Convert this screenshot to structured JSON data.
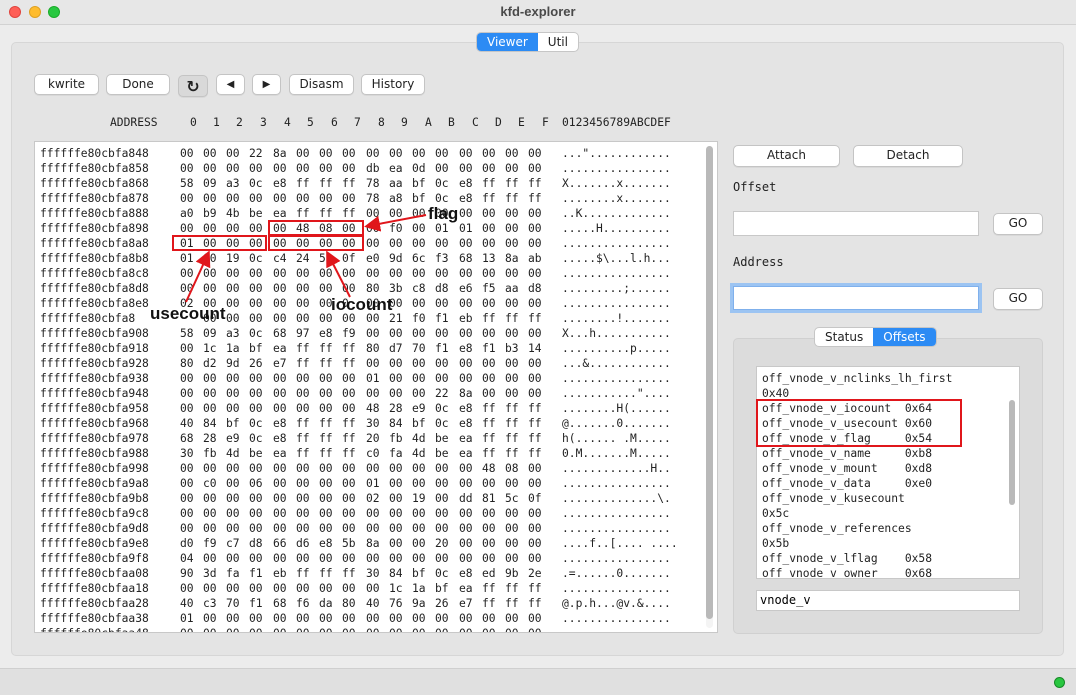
{
  "window": {
    "title": "kfd-explorer"
  },
  "tabs": [
    "Viewer",
    "Util"
  ],
  "toolbar": {
    "kwrite": "kwrite",
    "done": "Done",
    "refresh_icon": "↻",
    "prev_icon": "◀",
    "next_icon": "▶",
    "disasm": "Disasm",
    "history": "History"
  },
  "hex_header": {
    "address": "ADDRESS",
    "columns": [
      "0",
      "1",
      "2",
      "3",
      "4",
      "5",
      "6",
      "7",
      "8",
      "9",
      "A",
      "B",
      "C",
      "D",
      "E",
      "F"
    ],
    "ascii": "0123456789ABCDEF"
  },
  "hex_rows": [
    {
      "addr": "ffffffe80cbfa848",
      "bytes": [
        "00",
        "00",
        "00",
        "22",
        "8a",
        "00",
        "00",
        "00",
        "00",
        "00",
        "00",
        "00",
        "00",
        "00",
        "00",
        "00"
      ],
      "ascii": "...\"............"
    },
    {
      "addr": "ffffffe80cbfa858",
      "bytes": [
        "00",
        "00",
        "00",
        "00",
        "00",
        "00",
        "00",
        "00",
        "db",
        "ea",
        "0d",
        "00",
        "00",
        "00",
        "00",
        "00"
      ],
      "ascii": "................"
    },
    {
      "addr": "ffffffe80cbfa868",
      "bytes": [
        "58",
        "09",
        "a3",
        "0c",
        "e8",
        "ff",
        "ff",
        "ff",
        "78",
        "aa",
        "bf",
        "0c",
        "e8",
        "ff",
        "ff",
        "ff"
      ],
      "ascii": "X.......x......."
    },
    {
      "addr": "ffffffe80cbfa878",
      "bytes": [
        "00",
        "00",
        "00",
        "00",
        "00",
        "00",
        "00",
        "00",
        "78",
        "a8",
        "bf",
        "0c",
        "e8",
        "ff",
        "ff",
        "ff"
      ],
      "ascii": "........x......."
    },
    {
      "addr": "ffffffe80cbfa888",
      "bytes": [
        "a0",
        "b9",
        "4b",
        "be",
        "ea",
        "ff",
        "ff",
        "ff",
        "00",
        "00",
        "00",
        "00",
        "00",
        "00",
        "00",
        "00"
      ],
      "ascii": "..K............."
    },
    {
      "addr": "ffffffe80cbfa898",
      "bytes": [
        "00",
        "00",
        "00",
        "00",
        "00",
        "48",
        "08",
        "00",
        "00",
        "f0",
        "00",
        "01",
        "01",
        "00",
        "00",
        "00"
      ],
      "ascii": ".....H.........."
    },
    {
      "addr": "ffffffe80cbfa8a8",
      "bytes": [
        "01",
        "00",
        "00",
        "00",
        "00",
        "00",
        "00",
        "00",
        "00",
        "00",
        "00",
        "00",
        "00",
        "00",
        "00",
        "00"
      ],
      "ascii": "................"
    },
    {
      "addr": "ffffffe80cbfa8b8",
      "bytes": [
        "01",
        "00",
        "19",
        "0c",
        "c4",
        "24",
        "5",
        "0f",
        "e0",
        "9d",
        "6c",
        "f3",
        "68",
        "13",
        "8a",
        "ab"
      ],
      "ascii": ".....$\\...l.h..."
    },
    {
      "addr": "ffffffe80cbfa8c8",
      "bytes": [
        "00",
        "00",
        "00",
        "00",
        "00",
        "00",
        "00",
        "00",
        "00",
        "00",
        "00",
        "00",
        "00",
        "00",
        "00",
        "00"
      ],
      "ascii": "................"
    },
    {
      "addr": "ffffffe80cbfa8d8",
      "bytes": [
        "00",
        "00",
        "00",
        "00",
        "00",
        "00",
        "00",
        "00",
        "80",
        "3b",
        "c8",
        "d8",
        "e6",
        "f5",
        "aa",
        "d8"
      ],
      "ascii": ".........;......"
    },
    {
      "addr": "ffffffe80cbfa8e8",
      "bytes": [
        "02",
        "00",
        "00",
        "00",
        "00",
        "00",
        "00",
        "0",
        "00",
        "00",
        "00",
        "00",
        "00",
        "00",
        "00",
        "00"
      ],
      "ascii": "................"
    },
    {
      "addr": "ffffffe80cbfa8",
      "bytes": [
        "",
        "00",
        "00",
        "00",
        "00",
        "00",
        "00",
        "00",
        "00",
        "21",
        "f0",
        "f1",
        "eb",
        "ff",
        "ff",
        "ff"
      ],
      "ascii": "........!......."
    },
    {
      "addr": "ffffffe80cbfa908",
      "bytes": [
        "58",
        "09",
        "a3",
        "0c",
        "68",
        "97",
        "e8",
        "f9",
        "00",
        "00",
        "00",
        "00",
        "00",
        "00",
        "00",
        "00"
      ],
      "ascii": "X...h..........."
    },
    {
      "addr": "ffffffe80cbfa918",
      "bytes": [
        "00",
        "1c",
        "1a",
        "bf",
        "ea",
        "ff",
        "ff",
        "ff",
        "80",
        "d7",
        "70",
        "f1",
        "e8",
        "f1",
        "b3",
        "14"
      ],
      "ascii": "..........p....."
    },
    {
      "addr": "ffffffe80cbfa928",
      "bytes": [
        "80",
        "d2",
        "9d",
        "26",
        "e7",
        "ff",
        "ff",
        "ff",
        "00",
        "00",
        "00",
        "00",
        "00",
        "00",
        "00",
        "00"
      ],
      "ascii": "...&............"
    },
    {
      "addr": "ffffffe80cbfa938",
      "bytes": [
        "00",
        "00",
        "00",
        "00",
        "00",
        "00",
        "00",
        "00",
        "01",
        "00",
        "00",
        "00",
        "00",
        "00",
        "00",
        "00"
      ],
      "ascii": "................"
    },
    {
      "addr": "ffffffe80cbfa948",
      "bytes": [
        "00",
        "00",
        "00",
        "00",
        "00",
        "00",
        "00",
        "00",
        "00",
        "00",
        "00",
        "22",
        "8a",
        "00",
        "00",
        "00"
      ],
      "ascii": "...........\"...."
    },
    {
      "addr": "ffffffe80cbfa958",
      "bytes": [
        "00",
        "00",
        "00",
        "00",
        "00",
        "00",
        "00",
        "00",
        "48",
        "28",
        "e9",
        "0c",
        "e8",
        "ff",
        "ff",
        "ff"
      ],
      "ascii": "........H(......"
    },
    {
      "addr": "ffffffe80cbfa968",
      "bytes": [
        "40",
        "84",
        "bf",
        "0c",
        "e8",
        "ff",
        "ff",
        "ff",
        "30",
        "84",
        "bf",
        "0c",
        "e8",
        "ff",
        "ff",
        "ff"
      ],
      "ascii": "@.......0......."
    },
    {
      "addr": "ffffffe80cbfa978",
      "bytes": [
        "68",
        "28",
        "e9",
        "0c",
        "e8",
        "ff",
        "ff",
        "ff",
        "20",
        "fb",
        "4d",
        "be",
        "ea",
        "ff",
        "ff",
        "ff"
      ],
      "ascii": "h(...... .M....."
    },
    {
      "addr": "ffffffe80cbfa988",
      "bytes": [
        "30",
        "fb",
        "4d",
        "be",
        "ea",
        "ff",
        "ff",
        "ff",
        "c0",
        "fa",
        "4d",
        "be",
        "ea",
        "ff",
        "ff",
        "ff"
      ],
      "ascii": "0.M.......M....."
    },
    {
      "addr": "ffffffe80cbfa998",
      "bytes": [
        "00",
        "00",
        "00",
        "00",
        "00",
        "00",
        "00",
        "00",
        "00",
        "00",
        "00",
        "00",
        "00",
        "48",
        "08",
        "00"
      ],
      "ascii": ".............H.."
    },
    {
      "addr": "ffffffe80cbfa9a8",
      "bytes": [
        "00",
        "c0",
        "00",
        "06",
        "00",
        "00",
        "00",
        "00",
        "01",
        "00",
        "00",
        "00",
        "00",
        "00",
        "00",
        "00"
      ],
      "ascii": "................"
    },
    {
      "addr": "ffffffe80cbfa9b8",
      "bytes": [
        "00",
        "00",
        "00",
        "00",
        "00",
        "00",
        "00",
        "00",
        "02",
        "00",
        "19",
        "00",
        "dd",
        "81",
        "5c",
        "0f"
      ],
      "ascii": "..............\\."
    },
    {
      "addr": "ffffffe80cbfa9c8",
      "bytes": [
        "00",
        "00",
        "00",
        "00",
        "00",
        "00",
        "00",
        "00",
        "00",
        "00",
        "00",
        "00",
        "00",
        "00",
        "00",
        "00"
      ],
      "ascii": "................"
    },
    {
      "addr": "ffffffe80cbfa9d8",
      "bytes": [
        "00",
        "00",
        "00",
        "00",
        "00",
        "00",
        "00",
        "00",
        "00",
        "00",
        "00",
        "00",
        "00",
        "00",
        "00",
        "00"
      ],
      "ascii": "................"
    },
    {
      "addr": "ffffffe80cbfa9e8",
      "bytes": [
        "d0",
        "f9",
        "c7",
        "d8",
        "66",
        "d6",
        "e8",
        "5b",
        "8a",
        "00",
        "00",
        "20",
        "00",
        "00",
        "00",
        "00"
      ],
      "ascii": "....f..[.... ...."
    },
    {
      "addr": "ffffffe80cbfa9f8",
      "bytes": [
        "04",
        "00",
        "00",
        "00",
        "00",
        "00",
        "00",
        "00",
        "00",
        "00",
        "00",
        "00",
        "00",
        "00",
        "00",
        "00"
      ],
      "ascii": "................"
    },
    {
      "addr": "ffffffe80cbfaa08",
      "bytes": [
        "90",
        "3d",
        "fa",
        "f1",
        "eb",
        "ff",
        "ff",
        "ff",
        "30",
        "84",
        "bf",
        "0c",
        "e8",
        "ed",
        "9b",
        "2e"
      ],
      "ascii": ".=......0......."
    },
    {
      "addr": "ffffffe80cbfaa18",
      "bytes": [
        "00",
        "00",
        "00",
        "00",
        "00",
        "00",
        "00",
        "00",
        "00",
        "1c",
        "1a",
        "bf",
        "ea",
        "ff",
        "ff",
        "ff"
      ],
      "ascii": "................"
    },
    {
      "addr": "ffffffe80cbfaa28",
      "bytes": [
        "40",
        "c3",
        "70",
        "f1",
        "68",
        "f6",
        "da",
        "80",
        "40",
        "76",
        "9a",
        "26",
        "e7",
        "ff",
        "ff",
        "ff"
      ],
      "ascii": "@.p.h...@v.&...."
    },
    {
      "addr": "ffffffe80cbfaa38",
      "bytes": [
        "01",
        "00",
        "00",
        "00",
        "00",
        "00",
        "00",
        "00",
        "00",
        "00",
        "00",
        "00",
        "00",
        "00",
        "00",
        "00"
      ],
      "ascii": "................"
    },
    {
      "addr": "ffffffe80cbfaa48",
      "bytes": [
        "00",
        "00",
        "00",
        "00",
        "00",
        "00",
        "00",
        "00",
        "00",
        "00",
        "00",
        "00",
        "00",
        "00",
        "00",
        "00"
      ],
      "ascii": "................"
    }
  ],
  "annotations": {
    "flag": "flag",
    "usecount": "usecount",
    "iocount": "iocount",
    "color": "#e0161b"
  },
  "right_panel": {
    "attach": "Attach",
    "detach": "Detach",
    "offset_label": "Offset",
    "offset_value": "",
    "address_label": "Address",
    "address_value": "",
    "go": "GO",
    "subtabs": [
      "Status",
      "Offsets"
    ],
    "offsets": [
      "off_vnode_v_nclinks_lh_first",
      "0x40",
      "off_vnode_v_iocount  0x64",
      "off_vnode_v_usecount 0x60",
      "off_vnode_v_flag     0x54",
      "off_vnode_v_name     0xb8",
      "off_vnode_v_mount    0xd8",
      "off_vnode_v_data     0xe0",
      "off_vnode_v_kusecount",
      "0x5c",
      "off_vnode_v_references",
      "0x5b",
      "off_vnode_v_lflag    0x58",
      "off_vnode_v_owner    0x68"
    ],
    "filter_value": "vnode_v"
  },
  "colors": {
    "accent": "#2c8bf4",
    "highlight": "#e0161b",
    "status_ok": "#29c640"
  }
}
